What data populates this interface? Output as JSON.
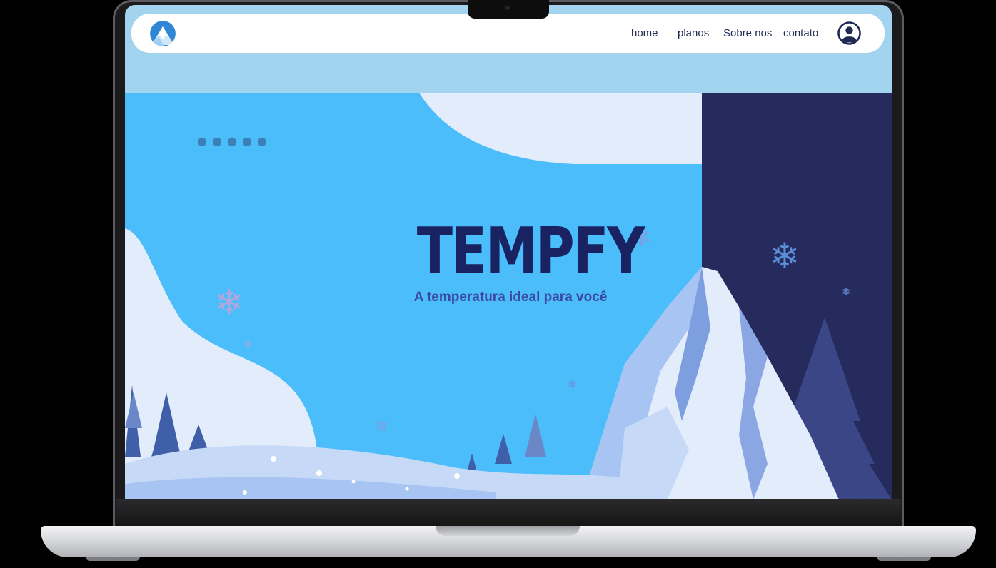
{
  "nav": {
    "links": [
      "home",
      "planos",
      "Sobre nos",
      "contato"
    ]
  },
  "hero": {
    "brand": "TEMPFY",
    "tagline": "A temperatura ideal para você",
    "carousel_dot_count": 5,
    "snowflake_glyph": "❄"
  },
  "icons": {
    "logo": "mountain-logo-icon",
    "profile": "user-circle-icon"
  },
  "colors": {
    "sky": "#4bbdfb",
    "navy_panel": "#262b5e",
    "brand_text": "#1a2361",
    "tagline_text": "#3b4aa0",
    "page_top": "#a3d4ef",
    "snow": "#e3ecfa"
  }
}
